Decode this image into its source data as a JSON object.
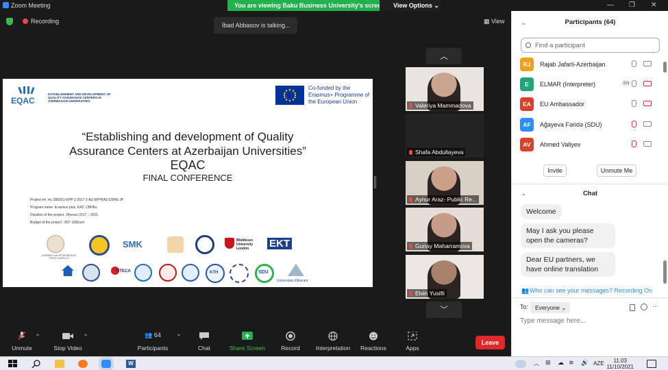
{
  "window": {
    "title": "Zoom Meeting",
    "banner_text": "You are viewing Baku Business University's screen",
    "view_options": "View Options"
  },
  "meeting": {
    "recording": "Recording",
    "talking": "İbad Abbasov is talking...",
    "view": "View"
  },
  "slide": {
    "eqac_header": "ESTABLISHMENT AND DEVELOPMENT OF QUALITY ASSURANCE CENTERS IN AZERBAIJAN UNIVERSITIES",
    "eqac_logo": "EQAC",
    "cofunded": "Co-funded by the Erasmus+ Programme of the European Union",
    "title_line1": "“Establishing and development of Quality",
    "title_line2": "Assurance Centers at Azerbaijan Universities”",
    "acronym": "EQAC",
    "final": "FINAL CONFERENCE",
    "meta": [
      "Project ref. no: 586351-EPP-1-2017-1-AZ-EPPKA2-CBHE-JP",
      "Program name: Erasmus plus, KA2, CBHEs",
      "Duration of the project:  34years 2017 – 2021",
      "Budget of the project :  897 193Euro"
    ],
    "logo_smk": "SMK",
    "logo_ekt": "EKT",
    "logo_middlesex": "Middlesex University London",
    "logo_az_ministry": "AZƏRBAYCAN RESPUBLİKASI TƏHSİL NAZİRLİYİ",
    "logo_alacant": "Universitat d'Alacant",
    "logo_kth": "KTH",
    "logo_sdu": "SDU",
    "logo_uteca": "UTECA"
  },
  "gallery": [
    {
      "name": "Valeriya Mammadova",
      "skin": "#c9a48e",
      "bg": "#e9e4df",
      "video": true
    },
    {
      "name": "Shafa Abdullayeva",
      "skin": "#232323",
      "bg": "#232323",
      "video": false
    },
    {
      "name": "Aynur Araz- Public Re...",
      "skin": "#caa188",
      "bg": "#d8d0c4",
      "video": true
    },
    {
      "name": "Gunay Maharramova",
      "skin": "#c69b86",
      "bg": "#e3ddd6",
      "video": true
    },
    {
      "name": "Elvin Yusifli",
      "skin": "#a9826c",
      "bg": "#ece7e2",
      "video": true
    }
  ],
  "toolbar": {
    "unmute": "Unmute",
    "stop_video": "Stop Video",
    "participants": "Participants",
    "participants_count": "64",
    "chat": "Chat",
    "share_screen": "Share Screen",
    "record": "Record",
    "interpretation": "Interpretation",
    "reactions": "Reactions",
    "apps": "Apps",
    "leave": "Leave"
  },
  "participants_panel": {
    "header": "Participants (64)",
    "search_placeholder": "Find a participant",
    "invite": "Invite",
    "unmute_me": "Unmute Me",
    "list": [
      {
        "initials": "RJ",
        "name": "Rajab Jafarli-Azerbaijan",
        "color": "#f2a11f",
        "mic_off": false,
        "cam_off": false,
        "badge": ""
      },
      {
        "initials": "E",
        "name": "ELMAR (Interpreter)",
        "color": "#23a37a",
        "mic_off": false,
        "cam_off": true,
        "badge": "EN"
      },
      {
        "initials": "EA",
        "name": "EU Ambassador",
        "color": "#d9412b",
        "mic_off": false,
        "cam_off": true,
        "badge": ""
      },
      {
        "initials": "AF",
        "name": "Ağayeva  Fəridə (SDU)",
        "color": "#2d8cff",
        "mic_off": true,
        "cam_off": false,
        "badge": ""
      },
      {
        "initials": "AV",
        "name": "Ahmed Valiyev",
        "color": "#d9412b",
        "mic_off": true,
        "cam_off": false,
        "badge": ""
      }
    ]
  },
  "chat_panel": {
    "header": "Chat",
    "messages": [
      "Welcome",
      "May I ask you please open the cameras?",
      "Dear EU partners, we have online translation"
    ],
    "who_can_see": "Who can see your messages? Recording On",
    "to_label": "To:",
    "recipient": "Everyone",
    "placeholder": "Type message here..."
  },
  "taskbar": {
    "time": "11:03",
    "date": "11/10/2021",
    "lang": "AZE"
  }
}
